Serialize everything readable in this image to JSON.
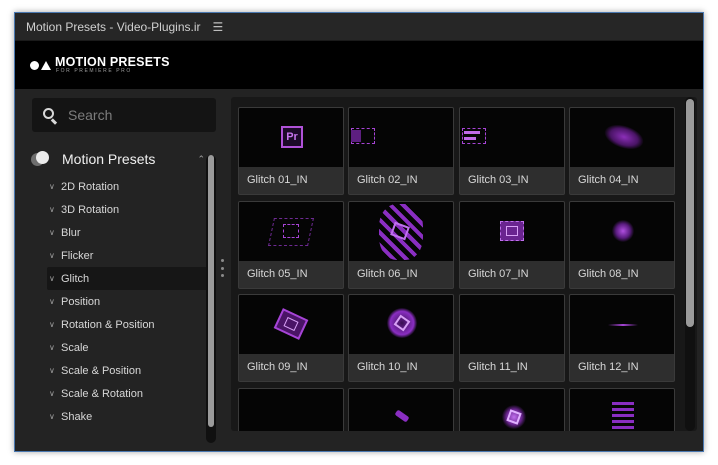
{
  "window": {
    "title": "Motion Presets - Video-Plugins.ir",
    "menu_icon": "hamburger-menu-icon"
  },
  "banner": {
    "logo_title": "MOTION PRESETS",
    "logo_subtitle": "FOR PREMIERE PRO"
  },
  "search": {
    "placeholder": "Search",
    "value": ""
  },
  "tree": {
    "title": "Motion Presets",
    "items": [
      {
        "label": "2D Rotation"
      },
      {
        "label": "3D Rotation"
      },
      {
        "label": "Blur"
      },
      {
        "label": "Flicker"
      },
      {
        "label": "Glitch"
      },
      {
        "label": "Position"
      },
      {
        "label": "Rotation & Position"
      },
      {
        "label": "Scale"
      },
      {
        "label": "Scale & Position"
      },
      {
        "label": "Scale & Rotation"
      },
      {
        "label": "Shake"
      }
    ],
    "selected": "Glitch"
  },
  "presets": [
    {
      "label": "Glitch 01_IN"
    },
    {
      "label": "Glitch 02_IN"
    },
    {
      "label": "Glitch 03_IN"
    },
    {
      "label": "Glitch 04_IN"
    },
    {
      "label": "Glitch 05_IN"
    },
    {
      "label": "Glitch 06_IN"
    },
    {
      "label": "Glitch 07_IN"
    },
    {
      "label": "Glitch 08_IN"
    },
    {
      "label": "Glitch 09_IN"
    },
    {
      "label": "Glitch 10_IN"
    },
    {
      "label": "Glitch 11_IN"
    },
    {
      "label": "Glitch 12_IN"
    },
    {
      "label": ""
    },
    {
      "label": ""
    },
    {
      "label": ""
    },
    {
      "label": ""
    }
  ],
  "thumbnail_pr_text": "Pr",
  "colors": {
    "accent_purple": "#b052d8",
    "panel_bg": "#232323",
    "content_bg": "#181818",
    "window_border": "#4a78b0"
  }
}
